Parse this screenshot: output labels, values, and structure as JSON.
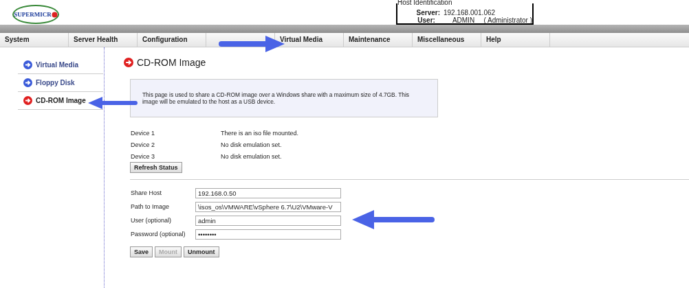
{
  "logo": {
    "text": "SUPERMICR"
  },
  "host_identification": {
    "title": "Host Identification",
    "server_label": "Server:",
    "server": "192.168.001.062",
    "user_label": "User:",
    "user": "ADMIN",
    "role": "( Administrator )"
  },
  "menu": [
    {
      "label": "System"
    },
    {
      "label": "Server Health"
    },
    {
      "label": "Configuration"
    },
    {
      "label": "Virtual Media"
    },
    {
      "label": "Maintenance"
    },
    {
      "label": "Miscellaneous"
    },
    {
      "label": "Help"
    }
  ],
  "sidebar": {
    "items": [
      {
        "label": "Virtual Media",
        "selected": false
      },
      {
        "label": "Floppy Disk",
        "selected": false
      },
      {
        "label": "CD-ROM Image",
        "selected": true
      }
    ]
  },
  "page": {
    "title": "CD-ROM Image",
    "info": "This page is used to share a CD-ROM image over a Windows share with a maximum size of 4.7GB. This image will be emulated to the host as a USB device."
  },
  "devices": [
    {
      "name": "Device 1",
      "status": "There is an iso file mounted."
    },
    {
      "name": "Device 2",
      "status": "No disk emulation set."
    },
    {
      "name": "Device 3",
      "status": "No disk emulation set."
    }
  ],
  "refresh_button": "Refresh Status",
  "form": [
    {
      "label": "Share Host",
      "value": "192.168.0.50"
    },
    {
      "label": "Path to Image",
      "value": "\\isos_os\\VMWARE\\vSphere 6.7\\U2\\VMware-V"
    },
    {
      "label": "User (optional)",
      "value": "admin"
    },
    {
      "label": "Password (optional)",
      "value": "••••••••"
    }
  ],
  "buttons": [
    {
      "label": "Save",
      "disabled": false
    },
    {
      "label": "Mount",
      "disabled": true
    },
    {
      "label": "Unmount",
      "disabled": false
    }
  ]
}
